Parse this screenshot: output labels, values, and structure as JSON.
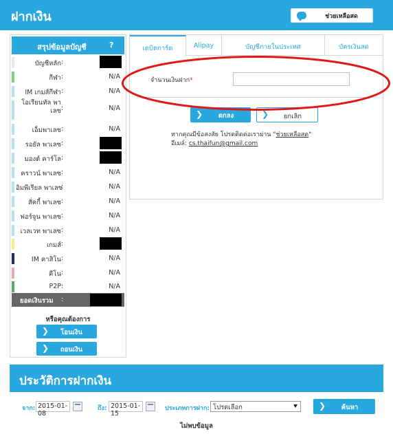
{
  "header": {
    "title": "ฝากเงิน",
    "help_label": "ช่วยเหลือสด"
  },
  "sidebar": {
    "title": "สรุปข้อมูลบัญชี",
    "help_mark": "?",
    "rows": [
      {
        "label": "บัญชีหลัก",
        "colon": ":",
        "value": "",
        "masked": true,
        "color": "#e8e8e8"
      },
      {
        "label": "กีฬา",
        "colon": ":",
        "value": "N/A",
        "masked": false,
        "color": "#7ed27e"
      },
      {
        "label": "IM เกมส์กีฬา",
        "colon": ":",
        "value": "N/A",
        "masked": false,
        "color": "#b6e3f6"
      },
      {
        "label": "โอเรียนทัล พาเลซ",
        "colon": ":",
        "value": "N/A",
        "masked": false,
        "color": "#b6e3f6"
      },
      {
        "label": "เอ็มพาเลซ",
        "colon": ":",
        "value": "N/A",
        "masked": false,
        "color": "#b6e3f6"
      },
      {
        "label": "รอยัล พาเลซ",
        "colon": ":",
        "value": "",
        "masked": true,
        "color": "#b6e3f6"
      },
      {
        "label": "มองต์ คาร์โล",
        "colon": ":",
        "value": "",
        "masked": true,
        "color": "#b6e3f6"
      },
      {
        "label": "คราวน์ พาเลซ",
        "colon": ":",
        "value": "N/A",
        "masked": false,
        "color": "#b6e3f6"
      },
      {
        "label": "อิมพีเรียล พาเลซ",
        "colon": ":",
        "value": "N/A",
        "masked": false,
        "color": "#b6e3f6"
      },
      {
        "label": "สั่คกี้ พาเลซ",
        "colon": ":",
        "value": "N/A",
        "masked": false,
        "color": "#b6e3f6"
      },
      {
        "label": "ฟอร์จูน พาเลซ",
        "colon": ":",
        "value": "N/A",
        "masked": false,
        "color": "#b6e3f6"
      },
      {
        "label": "เวลเวท พาเลซ",
        "colon": ":",
        "value": "N/A",
        "masked": false,
        "color": "#b6e3f6"
      },
      {
        "label": "เกมส์",
        "colon": ":",
        "value": "",
        "masked": true,
        "color": "#f7ee8a"
      },
      {
        "label": "IM คาสิโน",
        "colon": ":",
        "value": "N/A",
        "masked": false,
        "color": "#1d2c6b"
      },
      {
        "label": "คีโน",
        "colon": ":",
        "value": "N/A",
        "masked": false,
        "color": "#f4a6b0"
      },
      {
        "label": "P2P",
        "colon": ":",
        "value": "N/A",
        "masked": false,
        "color": "#5aa86c"
      }
    ],
    "total_label": "ยอดเงินรวม",
    "total_colon": ":",
    "question": "หรือคุณต้องการ",
    "transfer_label": "โอนเงิน",
    "withdraw_label": "ถอนเงิน"
  },
  "tabs": [
    {
      "label": "เดบิตการ์ด",
      "active": true
    },
    {
      "label": "Alipay",
      "active": false
    },
    {
      "label": "บัญชีภายในประเทศ",
      "active": false
    },
    {
      "label": "บัตรเงินสด",
      "active": false
    }
  ],
  "form": {
    "amount_label": "จำนวนเงินฝาก",
    "required_mark": "*",
    "amount_value": "",
    "ok_label": "ตกลง",
    "cancel_label": "ยกเลิก",
    "help_line1_prefix": "หากคุณมีข้อสงสัย โปรดติดต่อเราผ่าน \"",
    "help_link": "ช่วยเหลือสด",
    "help_line1_suffix": "\"",
    "email_prefix": "อีเมล์: ",
    "email": "cs.thaifun@gmail.com"
  },
  "history": {
    "title": "ประวัติการฝากเงิน",
    "from_label": "จาก:",
    "from_date": "2015-01-08",
    "to_label": "ถึง:",
    "to_date": "2015-01-15",
    "type_label": "ประเภทการฝาก:",
    "type_value": "โปรดเลือก",
    "search_label": "ค้นหา",
    "no_data": "ไม่พบข้อมูล"
  },
  "colors": {
    "primary": "#29a8e0",
    "annotation": "#e01818"
  }
}
